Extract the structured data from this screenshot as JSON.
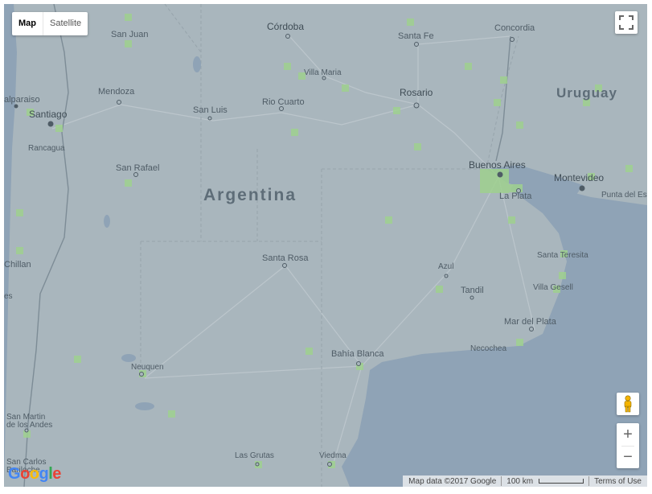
{
  "map_type": {
    "map": "Map",
    "satellite": "Satellite"
  },
  "places": {
    "cordoba": "Córdoba",
    "santa_fe": "Santa Fe",
    "concordia": "Concordia",
    "san_juan": "San Juan",
    "villa_maria": "Villa Maria",
    "valparaiso": "alparaiso",
    "mendoza": "Mendoza",
    "santiago": "Santiago",
    "san_luis": "San Luis",
    "rio_cuarto": "Rio Cuarto",
    "rosario": "Rosario",
    "uruguay": "Uruguay",
    "rancagua": "Rancagua",
    "san_rafael": "San Rafael",
    "buenos_aires": "Buenos Aires",
    "montevideo": "Montevideo",
    "la_plata": "La Plata",
    "punta_del_este": "Punta del Este",
    "argentina": "Argentina",
    "chillan": "Chillan",
    "santa_rosa": "Santa Rosa",
    "santa_teresita": "Santa Teresita",
    "azul": "Azul",
    "tandil": "Tandil",
    "villa_gesell": "Villa Gesell",
    "es": "es",
    "mar_del_plata": "Mar del Plata",
    "necochea": "Necochea",
    "bahia_blanca": "Bahía Blanca",
    "neuquen": "Neuquen",
    "san_martin": "San Martin",
    "de_los_andes": "de los Andes",
    "san_carlos": "San Carlos",
    "bariloche": "Bariloche",
    "las_grutas": "Las Grutas",
    "viedma": "Viedma"
  },
  "footer": {
    "map_data": "Map data ©2017 Google",
    "scale": "100 km",
    "terms": "Terms of Use"
  },
  "logo": "Google",
  "colors": {
    "land": "#a9b6bd",
    "ocean": "#90a4b8",
    "highlight": "#9fd18f"
  },
  "icons": [
    "fullscreen-icon",
    "pegman-icon",
    "zoom-in-icon",
    "zoom-out-icon"
  ]
}
